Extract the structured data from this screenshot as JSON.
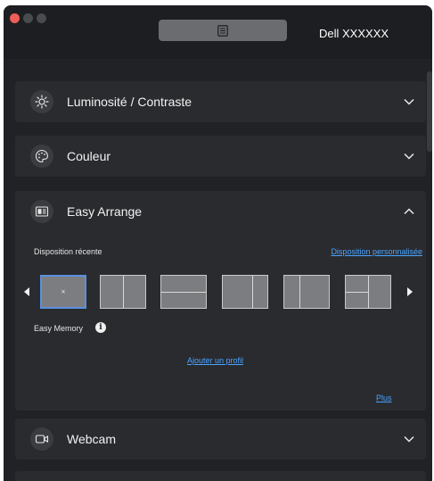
{
  "window": {
    "monitor_name": "Dell XXXXXX",
    "menu_icon": "list-icon"
  },
  "sections": [
    {
      "id": "brightness",
      "title": "Luminosité / Contraste",
      "icon": "sun-icon",
      "expanded": false
    },
    {
      "id": "color",
      "title": "Couleur",
      "icon": "palette-icon",
      "expanded": false
    },
    {
      "id": "easy_arrange",
      "title": "Easy Arrange",
      "icon": "layout-icon",
      "expanded": true
    },
    {
      "id": "webcam",
      "title": "Webcam",
      "icon": "camera-icon",
      "expanded": false
    }
  ],
  "easy_arrange": {
    "recent_label": "Disposition récente",
    "custom_link": "Disposition personnalisée",
    "selected_close": "×",
    "memory_label": "Easy Memory",
    "info_glyph": "i",
    "add_profile_link": "Ajouter un profil",
    "more_link": "Plus",
    "layouts": [
      "single",
      "two-columns",
      "two-rows",
      "two-columns-wide-left",
      "two-columns-narrow-left",
      "left-split-right-full"
    ],
    "selected_layout_index": 0
  },
  "colors": {
    "accent_link": "#4aa3ff",
    "selection": "#5b8fe0",
    "panel": "#2a2b2f",
    "background": "#202225"
  }
}
